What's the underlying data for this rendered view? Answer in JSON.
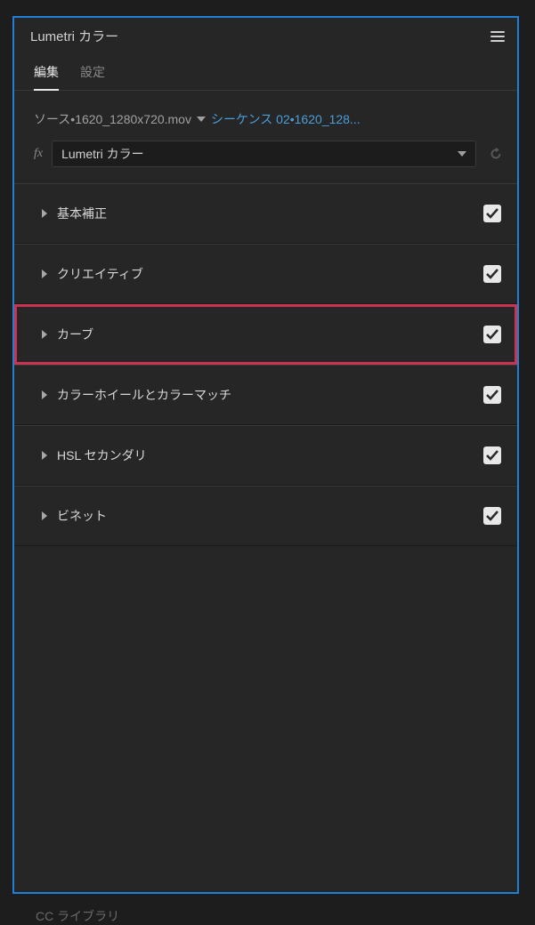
{
  "panel": {
    "title": "Lumetri カラー"
  },
  "tabs": {
    "edit": "編集",
    "settings": "設定"
  },
  "source": {
    "label": "ソース•1620_1280x720.mov",
    "sequence_link": "シーケンス 02•1620_128..."
  },
  "effect": {
    "fx_symbol": "fx",
    "name": "Lumetri カラー"
  },
  "sections": [
    {
      "label": "基本補正",
      "checked": true,
      "highlighted": false
    },
    {
      "label": "クリエイティブ",
      "checked": true,
      "highlighted": false
    },
    {
      "label": "カーブ",
      "checked": true,
      "highlighted": true
    },
    {
      "label": "カラーホイールとカラーマッチ",
      "checked": true,
      "highlighted": false
    },
    {
      "label": "HSL セカンダリ",
      "checked": true,
      "highlighted": false
    },
    {
      "label": "ビネット",
      "checked": true,
      "highlighted": false
    }
  ],
  "bottom": {
    "partial_text": "CC ライブラリ"
  }
}
